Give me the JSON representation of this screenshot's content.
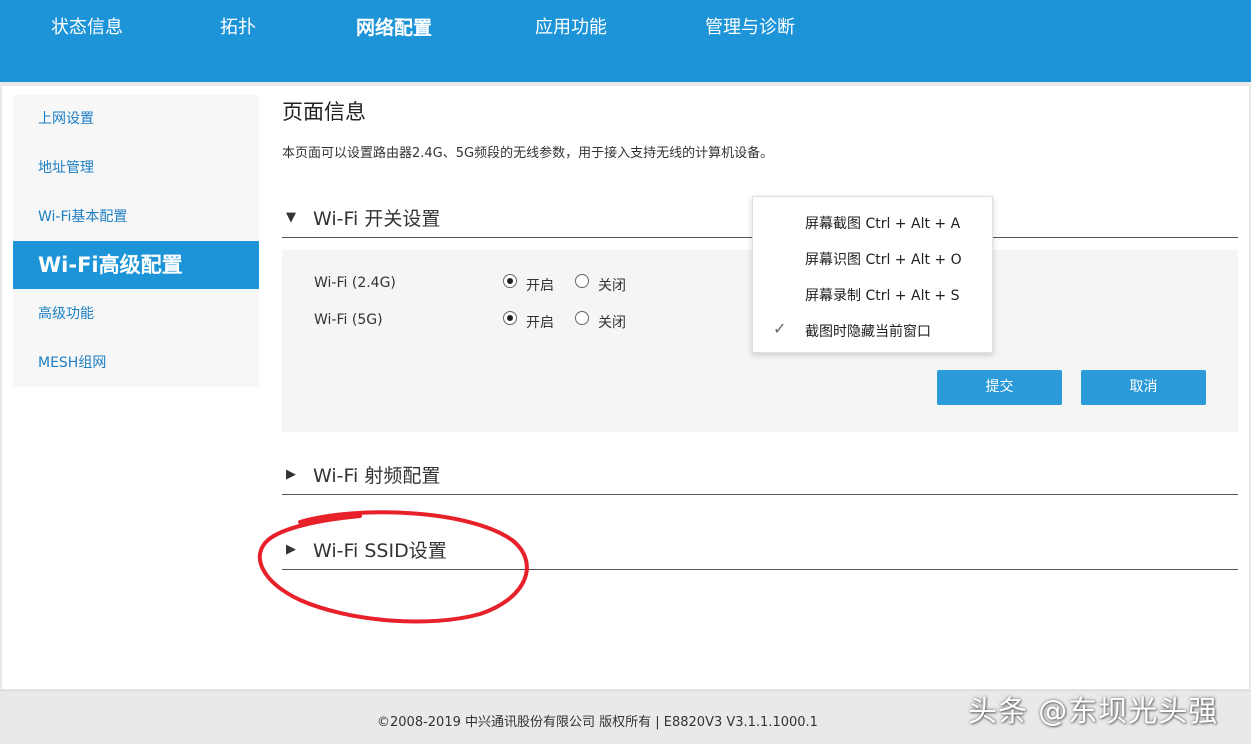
{
  "topnav": {
    "items": [
      "状态信息",
      "拓扑",
      "网络配置",
      "应用功能",
      "管理与诊断"
    ],
    "active": "网络配置"
  },
  "sidebar": {
    "items": [
      "上网设置",
      "地址管理",
      "Wi-Fi基本配置",
      "Wi-Fi高级配置",
      "高级功能",
      "MESH组网"
    ],
    "active": "Wi-Fi高级配置"
  },
  "page": {
    "title": "页面信息",
    "description": "本页面可以设置路由器2.4G、5G频段的无线参数，用于接入支持无线的计算机设备。"
  },
  "sections": {
    "switch": {
      "title": "Wi-Fi 开关设置",
      "expanded": true,
      "rows": [
        {
          "label": "Wi-Fi (2.4G)",
          "on_label": "开启",
          "off_label": "关闭",
          "value": "开启"
        },
        {
          "label": "Wi-Fi (5G)",
          "on_label": "开启",
          "off_label": "关闭",
          "value": "开启"
        }
      ],
      "submit_label": "提交",
      "cancel_label": "取消"
    },
    "radio": {
      "title": "Wi-Fi 射频配置",
      "expanded": false
    },
    "ssid": {
      "title": "Wi-Fi SSID设置",
      "expanded": false
    }
  },
  "context_menu": {
    "items": [
      {
        "label": "屏幕截图 Ctrl + Alt + A",
        "checked": false
      },
      {
        "label": "屏幕识图 Ctrl + Alt + O",
        "checked": false
      },
      {
        "label": "屏幕录制 Ctrl + Alt + S",
        "checked": false
      },
      {
        "label": "截图时隐藏当前窗口",
        "checked": true
      }
    ]
  },
  "footer": {
    "text": "©2008-2019 中兴通讯股份有限公司 版权所有  |   E8820V3 V3.1.1.1000.1"
  },
  "watermark": "头条 @东坝光头强",
  "colors": {
    "brand_blue": "#1d94d8",
    "button_blue": "#2a9ad9",
    "annotation_red": "#e8202a"
  }
}
